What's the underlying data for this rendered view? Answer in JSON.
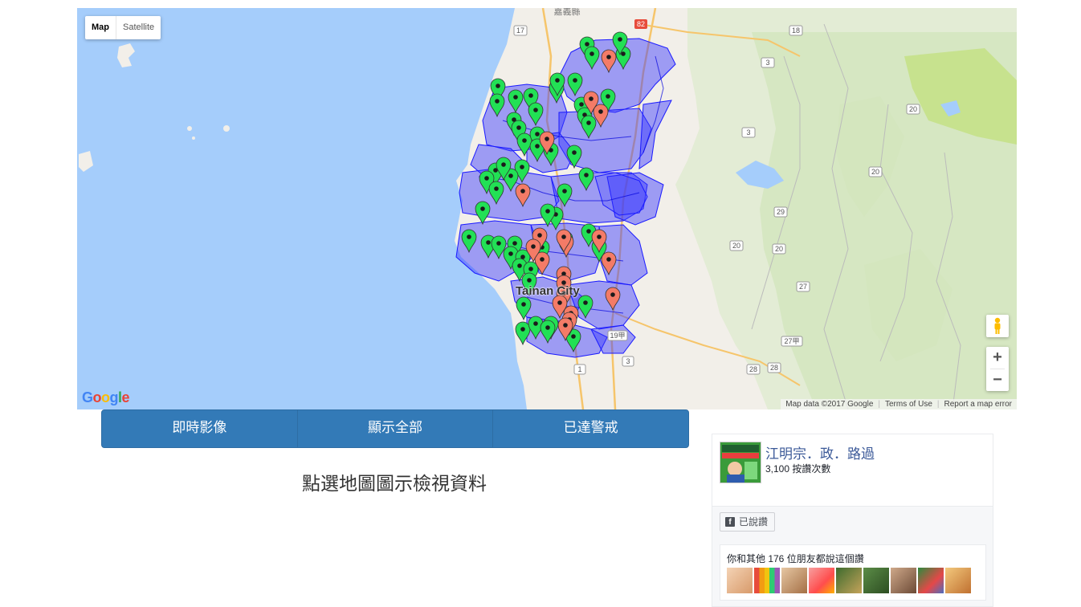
{
  "map": {
    "type_control": {
      "map_label": "Map",
      "satellite_label": "Satellite",
      "selected": "Map"
    },
    "city_label": "Tainan City",
    "attribution": {
      "data": "Map data ©2017 Google",
      "terms": "Terms of Use",
      "report": "Report a map error"
    },
    "logo": "Google",
    "zoom_in": "+",
    "zoom_out": "−",
    "road_labels": [
      "17",
      "82",
      "18",
      "3",
      "3",
      "20",
      "20",
      "29",
      "20",
      "20",
      "27",
      "27甲",
      "28",
      "28",
      "1",
      "3",
      "19甲"
    ],
    "place_label": "嘉義縣",
    "colors": {
      "water": "#a5cdfb",
      "land": "#f2efe9",
      "district_fill": "#3333ff",
      "marker_green": "#22e055",
      "marker_red": "#f47b67"
    },
    "markers": {
      "green_count": 57,
      "red_count": 20
    }
  },
  "buttons": {
    "live": "即時影像",
    "show_all": "顯示全部",
    "alert": "已達警戒"
  },
  "hint": "點選地圖圖示檢視資料",
  "fb": {
    "page_name": "江明宗．政．路過",
    "likes": "3,100 按讚次數",
    "liked_label": "已說讚",
    "friends_text": "你和其他 176 位朋友都說這個讚"
  }
}
